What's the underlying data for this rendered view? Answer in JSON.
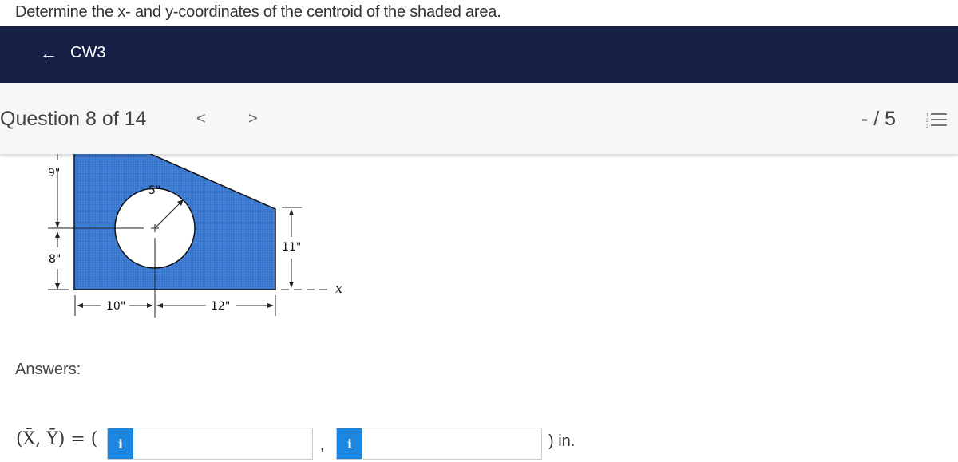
{
  "prompt": "Determine the x- and y-coordinates of the centroid of the shaded area.",
  "topbar": {
    "back_icon": "arrow-left-icon",
    "back_label": "CW3"
  },
  "question_bar": {
    "title": "Question 8 of 14",
    "prev": "<",
    "next": ">",
    "score": "- / 5",
    "list_icon": "numbered-list-icon"
  },
  "figure": {
    "labels": {
      "dim_9": "9\"",
      "dim_8": "8\"",
      "dim_5": "5\"",
      "dim_11": "11\"",
      "dim_10": "10\"",
      "dim_12": "12\"",
      "axis_x": "x"
    },
    "colors": {
      "fill": "#3a78d0",
      "outline": "#111111"
    }
  },
  "answers": {
    "heading": "Answers:",
    "equation": "(X̄, Ȳ) = (",
    "x_field": {
      "icon": "i",
      "value": ""
    },
    "separator": ",",
    "y_field": {
      "icon": "i",
      "value": ""
    },
    "unit": ") in."
  }
}
